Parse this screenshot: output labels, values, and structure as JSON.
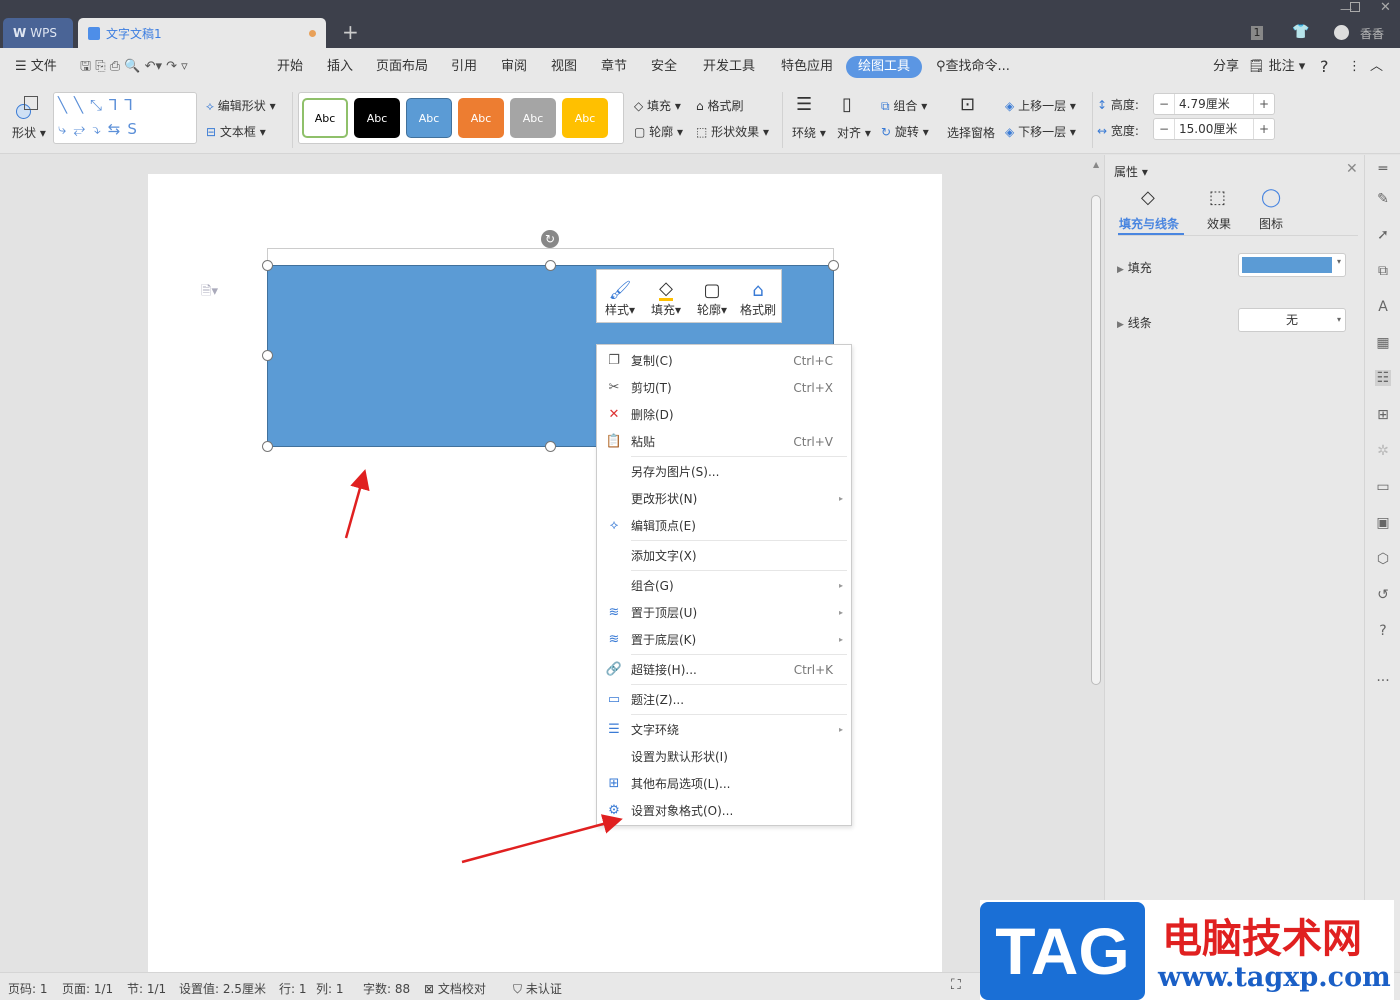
{
  "titlebar": {
    "wps_tab": "WPS",
    "doc_tab": "文字文稿1",
    "new_tab": "+",
    "badge": "1",
    "user": "香香"
  },
  "menubar": {
    "file": "文件",
    "tabs": [
      "开始",
      "插入",
      "页面布局",
      "引用",
      "审阅",
      "视图",
      "章节",
      "安全",
      "开发工具",
      "特色应用",
      "绘图工具"
    ],
    "search": "查找命令...",
    "share": "分享",
    "comment": "批注",
    "help": "?"
  },
  "ribbon": {
    "shape": "形状",
    "edit_shape": "编辑形状",
    "textbox": "文本框",
    "style_label": "Abc",
    "fill": "填充",
    "outline": "轮廓",
    "format_painter": "格式刷",
    "shape_effect": "形状效果",
    "wrap": "环绕",
    "align": "对齐",
    "group": "组合",
    "rotate": "旋转",
    "selection_pane": "选择窗格",
    "bring_forward": "上移一层",
    "send_backward": "下移一层",
    "height_label": "高度:",
    "height_value": "4.79厘米",
    "width_label": "宽度:",
    "width_value": "15.00厘米"
  },
  "style_colors": [
    "#ffffff",
    "#000000",
    "#5b9bd5",
    "#ed7d31",
    "#a5a5a5",
    "#ffc000"
  ],
  "minibar": {
    "style": "样式",
    "fill": "填充",
    "outline": "轮廓",
    "painter": "格式刷"
  },
  "context_menu": [
    {
      "label": "复制(C)",
      "shortcut": "Ctrl+C",
      "icon": "copy-icon",
      "glyph": "❐"
    },
    {
      "label": "剪切(T)",
      "shortcut": "Ctrl+X",
      "icon": "scissors-icon",
      "glyph": "✂"
    },
    {
      "label": "删除(D)",
      "shortcut": "",
      "icon": "delete-icon",
      "glyph": "✕"
    },
    {
      "label": "粘贴",
      "shortcut": "Ctrl+V",
      "icon": "paste-icon",
      "glyph": "📋"
    },
    {
      "label": "另存为图片(S)..."
    },
    {
      "label": "更改形状(N)",
      "sub": true
    },
    {
      "label": "编辑顶点(E)",
      "icon": "edit-points-icon",
      "glyph": "⟡"
    },
    {
      "label": "添加文字(X)"
    },
    {
      "label": "组合(G)",
      "sub": true
    },
    {
      "label": "置于顶层(U)",
      "sub": true,
      "icon": "bring-front-icon",
      "glyph": "≋"
    },
    {
      "label": "置于底层(K)",
      "sub": true,
      "icon": "send-back-icon",
      "glyph": "≋"
    },
    {
      "label": "超链接(H)...",
      "shortcut": "Ctrl+K",
      "icon": "link-icon",
      "glyph": "🔗"
    },
    {
      "label": "题注(Z)...",
      "icon": "caption-icon",
      "glyph": "▭"
    },
    {
      "label": "文字环绕",
      "sub": true,
      "icon": "wrap-icon",
      "glyph": "☰"
    },
    {
      "label": "设置为默认形状(I)"
    },
    {
      "label": "其他布局选项(L)...",
      "icon": "layout-icon",
      "glyph": "⊞"
    },
    {
      "label": "设置对象格式(O)...",
      "icon": "format-icon",
      "glyph": "⚙"
    }
  ],
  "panel": {
    "title": "属性",
    "tabs": [
      "填充与线条",
      "效果",
      "图标"
    ],
    "fill_label": "填充",
    "fill_color": "#5b9bd5",
    "line_label": "线条",
    "line_value": "无"
  },
  "status": {
    "page_no": "页码: 1",
    "pages": "页面: 1/1",
    "section": "节: 1/1",
    "setting": "设置值: 2.5厘米",
    "row": "行: 1",
    "col": "列: 1",
    "words": "字数: 88",
    "proof": "文档校对",
    "cert": "未认证"
  },
  "watermark": {
    "tag": "TAG",
    "site": "电脑技术网",
    "url": "www.tagxp.com"
  }
}
